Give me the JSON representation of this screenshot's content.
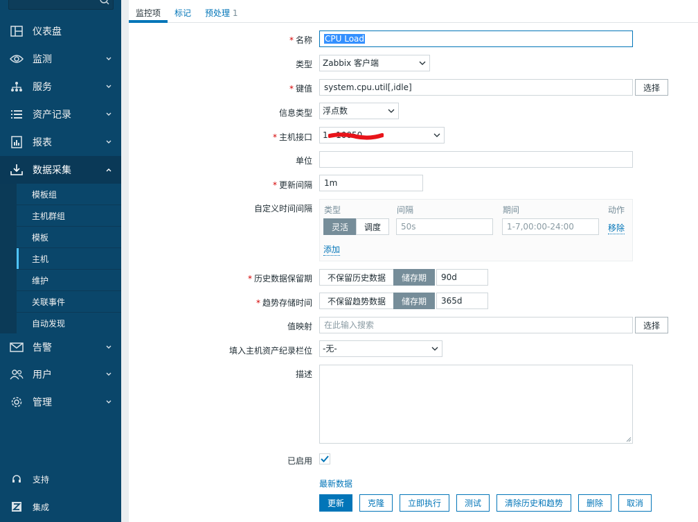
{
  "sidebar": {
    "items": [
      {
        "label": "仪表盘",
        "icon": "dashboard-icon"
      },
      {
        "label": "监测",
        "icon": "eye-icon"
      },
      {
        "label": "服务",
        "icon": "hierarchy-icon"
      },
      {
        "label": "资产记录",
        "icon": "list-icon"
      },
      {
        "label": "报表",
        "icon": "report-icon"
      },
      {
        "label": "数据采集",
        "icon": "download-icon"
      },
      {
        "label": "告警",
        "icon": "envelope-icon"
      },
      {
        "label": "用户",
        "icon": "users-icon"
      },
      {
        "label": "管理",
        "icon": "gear-icon"
      }
    ],
    "submenu": [
      "模板组",
      "主机群组",
      "模板",
      "主机",
      "维护",
      "关联事件",
      "自动发现"
    ],
    "bottom": [
      {
        "label": "支持",
        "icon": "headset-icon"
      },
      {
        "label": "集成",
        "icon": "zabbix-icon"
      }
    ]
  },
  "tabs": {
    "items": [
      "监控项",
      "标记",
      "预处理"
    ],
    "preprocessing_count": "1"
  },
  "form": {
    "name_label": "名称",
    "name_value": "CPU Load",
    "type_label": "类型",
    "type_value": "Zabbix 客户端",
    "key_label": "键值",
    "key_value": "system.cpu.util[,idle]",
    "select_label": "选择",
    "info_type_label": "信息类型",
    "info_type_value": "浮点数",
    "host_interface_label": "主机接口",
    "host_interface_value": "1   10050",
    "units_label": "单位",
    "units_value": "",
    "update_interval_label": "更新间隔",
    "update_interval_value": "1m",
    "custom_intervals_label": "自定义时间间隔",
    "custom_intervals": {
      "col_type": "类型",
      "col_interval": "间隔",
      "col_period": "期间",
      "col_action": "动作",
      "seg_flexible": "灵活",
      "seg_scheduling": "调度",
      "interval_placeholder": "50s",
      "period_placeholder": "1-7,00:00-24:00",
      "remove": "移除",
      "add": "添加"
    },
    "history_label": "历史数据保留期",
    "history_seg_off": "不保留历史数据",
    "history_seg_on": "储存期",
    "history_value": "90d",
    "trends_label": "趋势存储时间",
    "trends_seg_off": "不保留趋势数据",
    "trends_seg_on": "储存期",
    "trends_value": "365d",
    "valuemap_label": "值映射",
    "valuemap_placeholder": "在此输入搜索",
    "inventory_label": "填入主机资产纪录栏位",
    "inventory_value": "-无-",
    "description_label": "描述",
    "description_value": "",
    "enabled_label": "已启用",
    "enabled": true,
    "latest_data": "最新数据"
  },
  "buttons": {
    "update": "更新",
    "clone": "克隆",
    "execute_now": "立即执行",
    "test": "测试",
    "clear_history": "清除历史和趋势",
    "delete": "删除",
    "cancel": "取消"
  },
  "colors": {
    "sidebar_bg": "#0a466a",
    "accent": "#0275b8",
    "required": "#d40000",
    "segment_on": "#768d99"
  }
}
